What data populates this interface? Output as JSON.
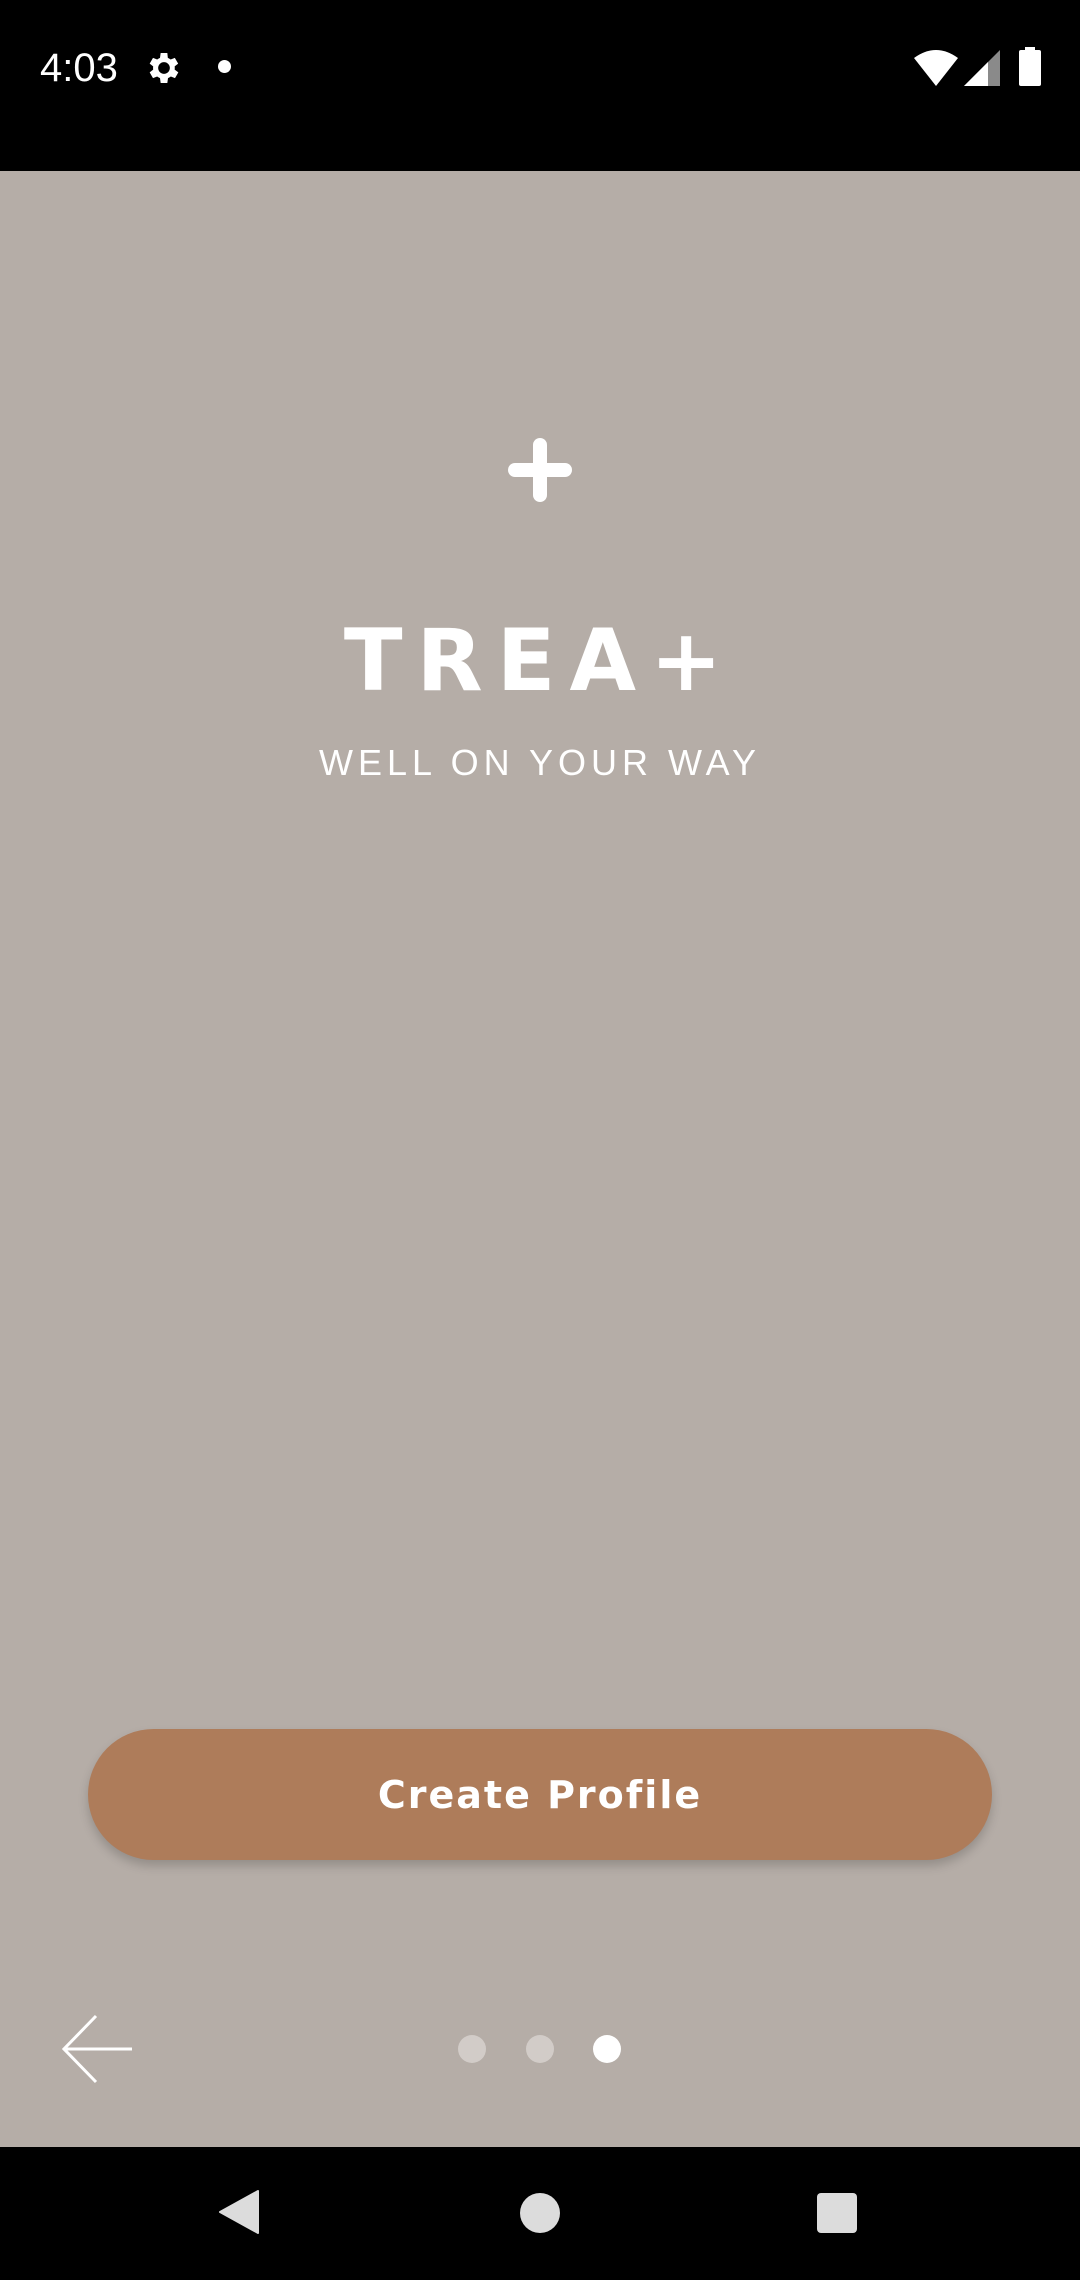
{
  "status_bar": {
    "time": "4:03",
    "icons": [
      "gear-icon",
      "notification-dot-icon",
      "wifi-icon",
      "cell-signal-icon",
      "battery-icon"
    ]
  },
  "branding": {
    "logo_icon": "plus-icon",
    "name": "TREA+",
    "tagline": "WELL ON YOUR WAY"
  },
  "actions": {
    "create_profile_label": "Create Profile",
    "back_icon": "arrow-left-icon"
  },
  "pager": {
    "total_pages": 3,
    "current_page": 3
  },
  "colors": {
    "background": "#b5ada7",
    "button": "#ae7c5a",
    "text": "#ffffff",
    "dot_active": "#ffffff",
    "dot_inactive": "#d2ccc8"
  },
  "system_nav": {
    "icons": [
      "nav-back-icon",
      "nav-home-icon",
      "nav-recents-icon"
    ]
  }
}
